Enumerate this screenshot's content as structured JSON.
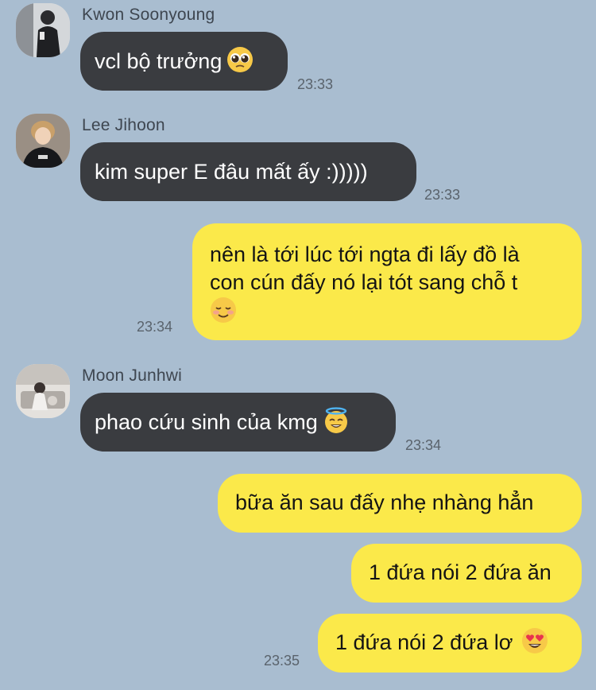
{
  "messages": [
    {
      "sender": "Kwon Soonyoung",
      "text": "vcl bộ trưởng",
      "emoji": "pleading-face-emoji",
      "time": "23:33"
    },
    {
      "sender": "Lee Jihoon",
      "text": "kim super E đâu mất ấy :)))))",
      "time": "23:33"
    },
    {
      "text_line1": "nên là tới lúc tới ngta đi lấy đồ là",
      "text_line2": "con cún đấy nó lại tót sang chỗ t",
      "emoji": "smiling-face-emoji",
      "time": "23:34"
    },
    {
      "sender": "Moon Junhwi",
      "text": "phao cứu sinh của kmg",
      "emoji": "smiling-face-with-halo-emoji",
      "time": "23:34"
    },
    {
      "text": "bữa ăn sau đấy nhẹ nhàng hẳn"
    },
    {
      "text": "1 đứa nói 2 đứa ăn"
    },
    {
      "text": "1 đứa nói 2 đứa lơ",
      "emoji": "heart-eyes-emoji",
      "time": "23:35"
    }
  ],
  "colors": {
    "background": "#a9bdd0",
    "incoming_bubble": "#3a3c40",
    "outgoing_bubble": "#fbe94a"
  }
}
